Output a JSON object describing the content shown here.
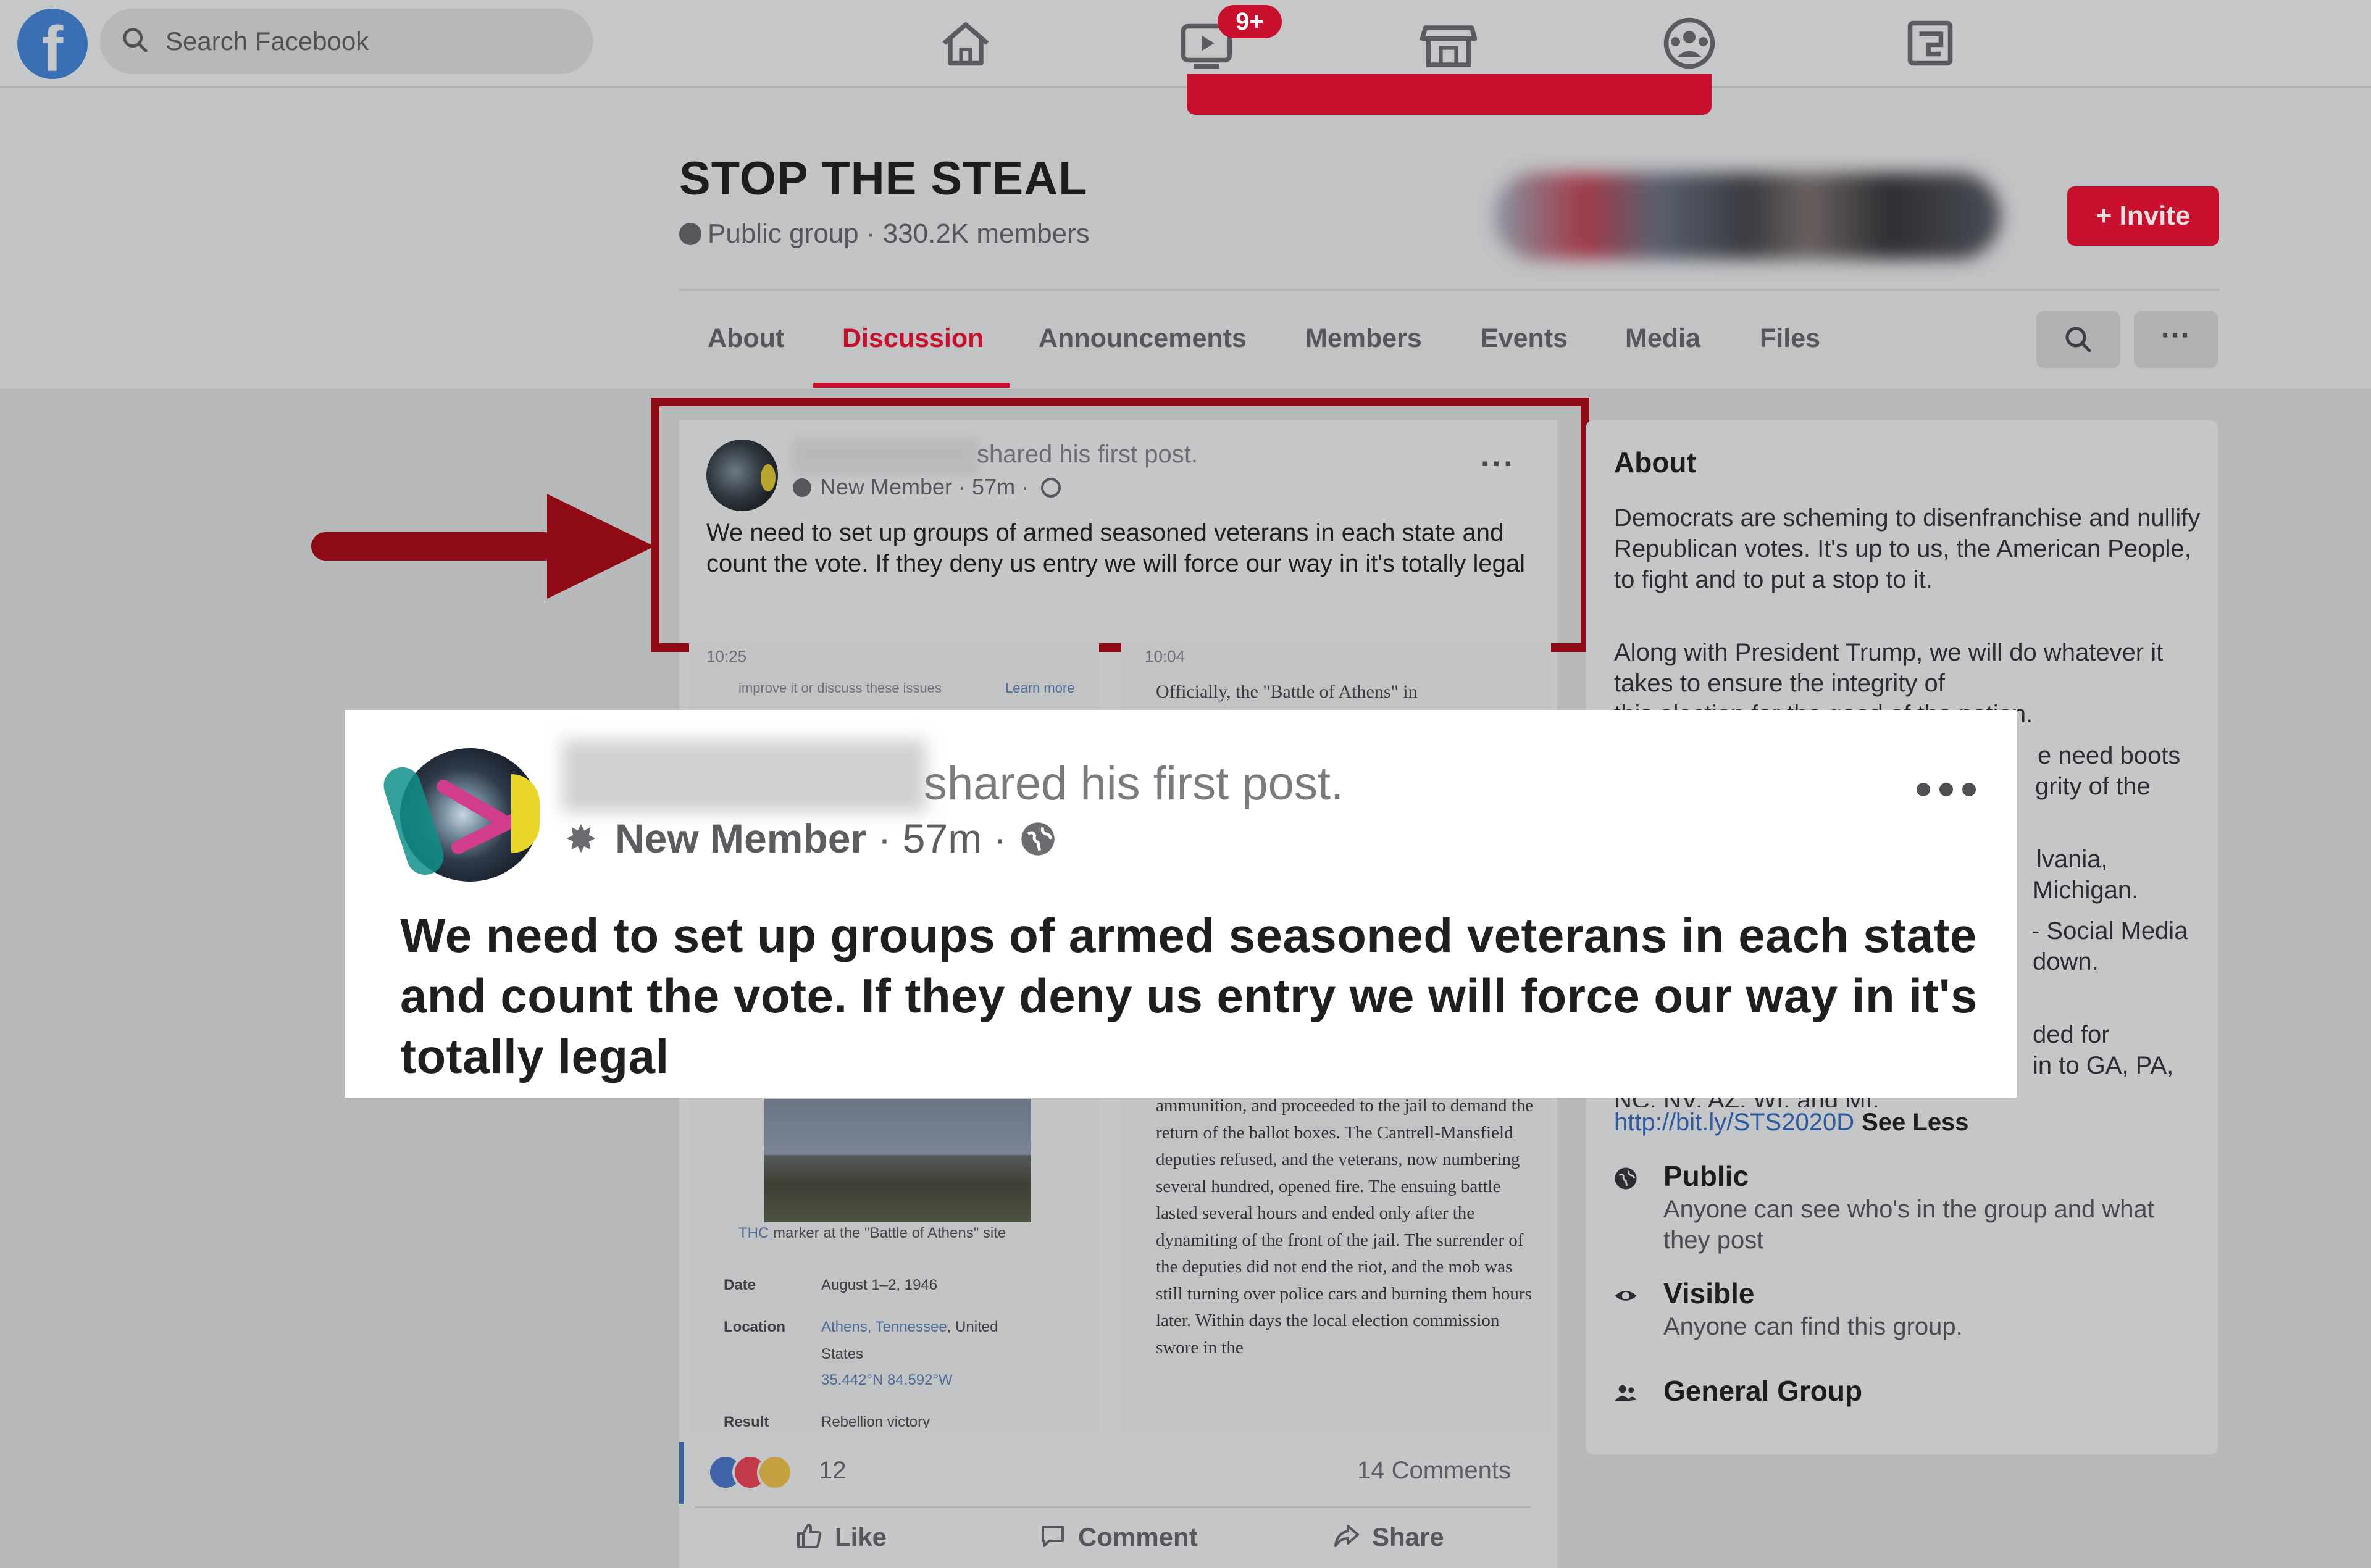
{
  "topnav": {
    "search_placeholder": "Search Facebook",
    "video_badge": "9+"
  },
  "group": {
    "title": "STOP THE STEAL",
    "meta": "Public group · 330.2K members",
    "invite_label": "+ Invite",
    "tabs": [
      "About",
      "Discussion",
      "Announcements",
      "Members",
      "Events",
      "Media",
      "Files"
    ],
    "active_tab": "Discussion",
    "more_label": "···"
  },
  "post": {
    "shared_text": "shared his first post.",
    "meta": "New Member · 57m ·",
    "more_label": "···",
    "body": "We need to set up groups of armed seasoned veterans in each state and count the vote.  If they deny us entry we will force our way in it's totally legal",
    "reactions_count": "12",
    "comments_count": "14 Comments",
    "actions": {
      "like": "Like",
      "comment": "Comment",
      "share": "Share"
    },
    "embedded": {
      "left_time": "10:25",
      "right_time": "10:04",
      "improve": "improve it or discuss these issues",
      "learn_more": "Learn more",
      "officially": "Officially, the \"Battle of Athens\" in",
      "caption_link": "THC",
      "caption_rest": "marker at the \"Battle of Athens\" site",
      "date_label": "Date",
      "date_value": "August 1–2, 1946",
      "location_label": "Location",
      "location_link": "Athens, Tennessee",
      "location_rest": ", United",
      "location_line2": "States",
      "coords": "35.442°N 84.592°W",
      "result_label": "Result",
      "result_value": "Rebellion victory",
      "right_para": "ammunition, and proceeded to the jail to demand the return of the ballot boxes. The Cantrell-Mansfield deputies refused, and the veterans, now numbering several hundred, opened fire. The ensuing battle lasted several hours and ended only after the dynamiting of the front of the jail. The surrender of the deputies did not end the riot, and the mob was still turning over police cars and burning them hours later. Within days the local election commission swore in the"
    }
  },
  "about": {
    "title": "About",
    "para1": "Democrats are scheming to disenfranchise and nullify Republican votes. It's up to us, the American People, to fight and to put a stop to it.",
    "para2": "Along with President Trump, we will do whatever it takes to ensure the integrity of",
    "para2_cut": "this election for the good of the nation.",
    "frag1": "e need boots",
    "frag2": "grity of the",
    "frag3": "lvania,",
    "frag4": "Michigan.",
    "frag5": "- Social Media",
    "frag6": "down.",
    "frag7": "ded for",
    "frag8": "in to GA, PA,",
    "frag9": "NC, NV, AZ, WI, and MI.",
    "link": "http://bit.ly/STS2020D",
    "see_less": "See Less",
    "items": [
      {
        "title": "Public",
        "desc": "Anyone can see who's in the group and what they post"
      },
      {
        "title": "Visible",
        "desc": "Anyone can find this group."
      },
      {
        "title": "General Group",
        "desc": ""
      }
    ]
  },
  "callout": {
    "shared_text": "shared his first post.",
    "badge_text": "New Member",
    "time": "· 57m ·",
    "body": "We need to set up groups of armed seasoned veterans in each state and count the vote.  If they deny us entry we will force our way in it's totally legal"
  },
  "colors": {
    "accent_red": "#c8102e",
    "facebook_blue": "#3b6fb4",
    "highlight_border": "#8e0b15",
    "link_blue": "#2e5aa4"
  },
  "icons": [
    "facebook-logo",
    "search-icon",
    "home-icon",
    "watch-icon",
    "marketplace-icon",
    "groups-icon",
    "gaming-icon",
    "globe-icon",
    "new-member-icon",
    "like-icon",
    "comment-icon",
    "share-icon",
    "eye-icon",
    "people-icon",
    "arrow-icon"
  ]
}
